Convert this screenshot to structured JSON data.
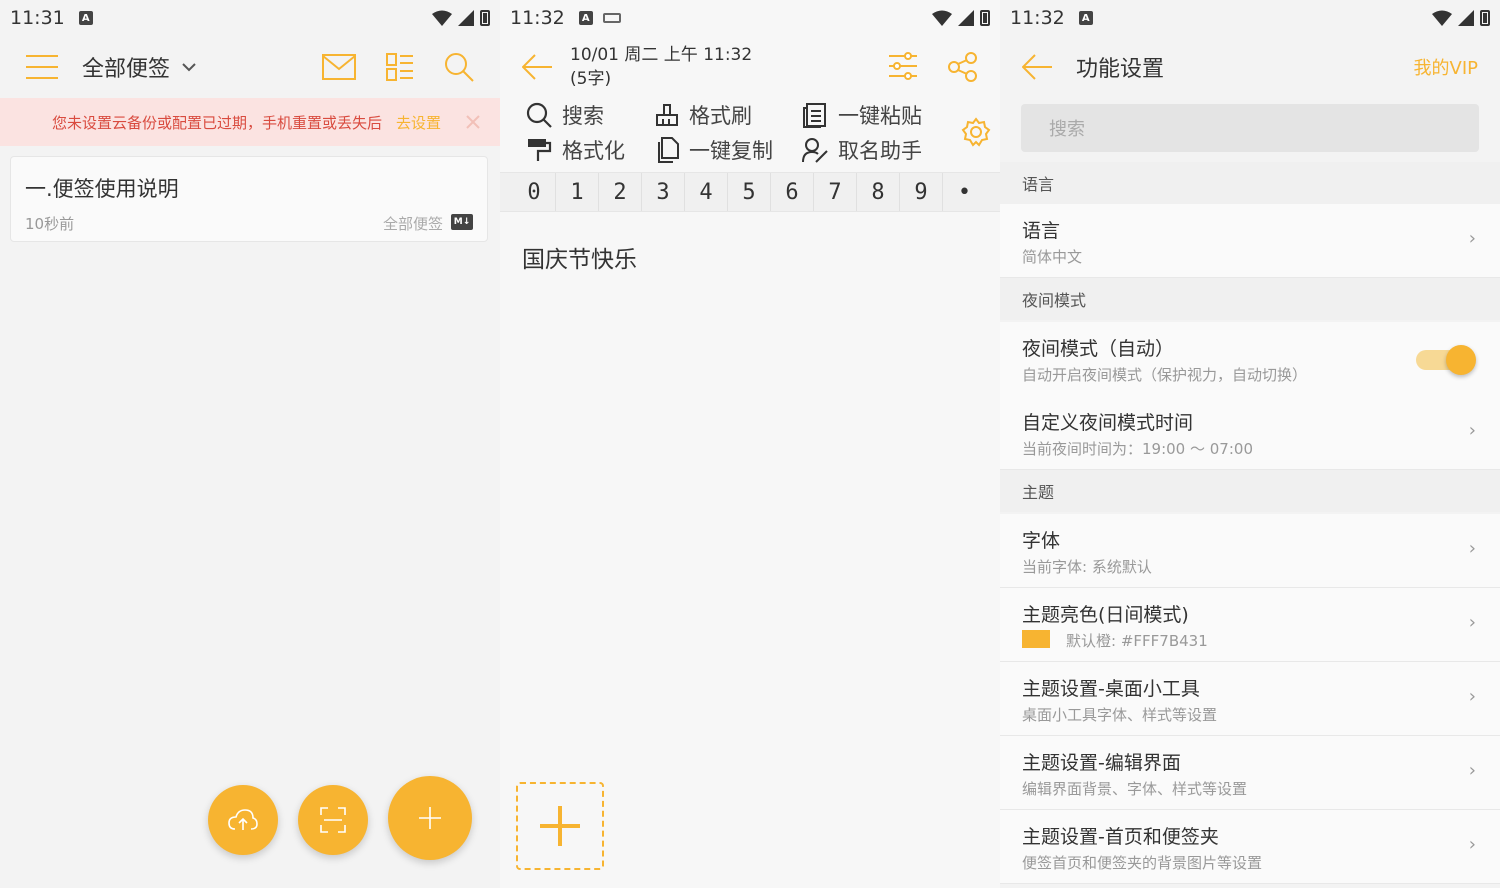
{
  "screens": {
    "notes_list": {
      "status": {
        "time": "11:31"
      },
      "title": "全部便签",
      "banner": {
        "text": "您未设置云备份或配置已过期，手机重置或丢失后",
        "link": "去设置"
      },
      "note": {
        "title": "一.便签使用说明",
        "time": "10秒前",
        "folder": "全部便签",
        "badge": "M↓"
      }
    },
    "editor": {
      "status": {
        "time": "11:32"
      },
      "date": "10/01 周二 上午 11:32",
      "count": "(5字)",
      "tools": {
        "search": "搜索",
        "format_brush": "格式刷",
        "paste": "一键粘贴",
        "format": "格式化",
        "copy": "一键复制",
        "naming": "取名助手"
      },
      "numbers": [
        "0",
        "1",
        "2",
        "3",
        "4",
        "5",
        "6",
        "7",
        "8",
        "9",
        "•"
      ],
      "content": "国庆节快乐"
    },
    "settings": {
      "status": {
        "time": "11:32"
      },
      "title": "功能设置",
      "vip": "我的VIP",
      "search_placeholder": "搜索",
      "sections": {
        "language": "语言",
        "night": "夜间模式",
        "theme": "主题"
      },
      "rows": {
        "language": {
          "title": "语言",
          "sub": "简体中文"
        },
        "night_auto": {
          "title": "夜间模式（自动）",
          "sub": "自动开启夜间模式（保护视力，自动切换）",
          "enabled": true
        },
        "night_time": {
          "title": "自定义夜间模式时间",
          "sub": "当前夜间时间为：19:00 ～ 07:00"
        },
        "font": {
          "title": "字体",
          "sub": "当前字体: 系统默认"
        },
        "theme_color": {
          "title": "主题亮色(日间模式)",
          "sub": "默认橙: #FFF7B431"
        },
        "theme_widget": {
          "title": "主题设置-桌面小工具",
          "sub": "桌面小工具字体、样式等设置"
        },
        "theme_editor": {
          "title": "主题设置-编辑界面",
          "sub": "编辑界面背景、字体、样式等设置"
        },
        "theme_home": {
          "title": "主题设置-首页和便签夹",
          "sub": "便签首页和便签夹的背景图片等设置"
        }
      }
    }
  },
  "colors": {
    "accent": "#f7b431",
    "banner_bg": "#fbe3e1",
    "banner_text": "#d94b3f"
  }
}
